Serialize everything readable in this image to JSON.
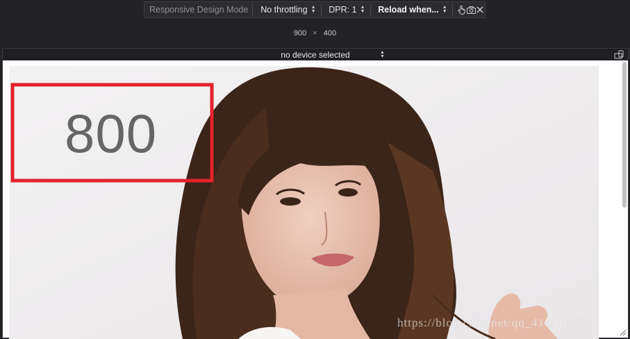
{
  "toolbar": {
    "title": "Responsive Design Mode",
    "throttling": "No throttling",
    "dpr": "DPR: 1",
    "reload": "Reload when..."
  },
  "dimensions": {
    "width": "900",
    "separator": "×",
    "height": "400"
  },
  "device_selector": "no device selected",
  "content": {
    "box_number": "800",
    "box_color": "#e3222a",
    "number_color": "#666666"
  },
  "watermark": "https://blog.csdn.net/qq_41821690",
  "colors": {
    "background": "#232327",
    "toolbar_bg": "#2b2b30",
    "page_bg": "#ffffff"
  },
  "icons": [
    "touch-icon",
    "camera-icon",
    "close-icon",
    "rotate-icon"
  ]
}
